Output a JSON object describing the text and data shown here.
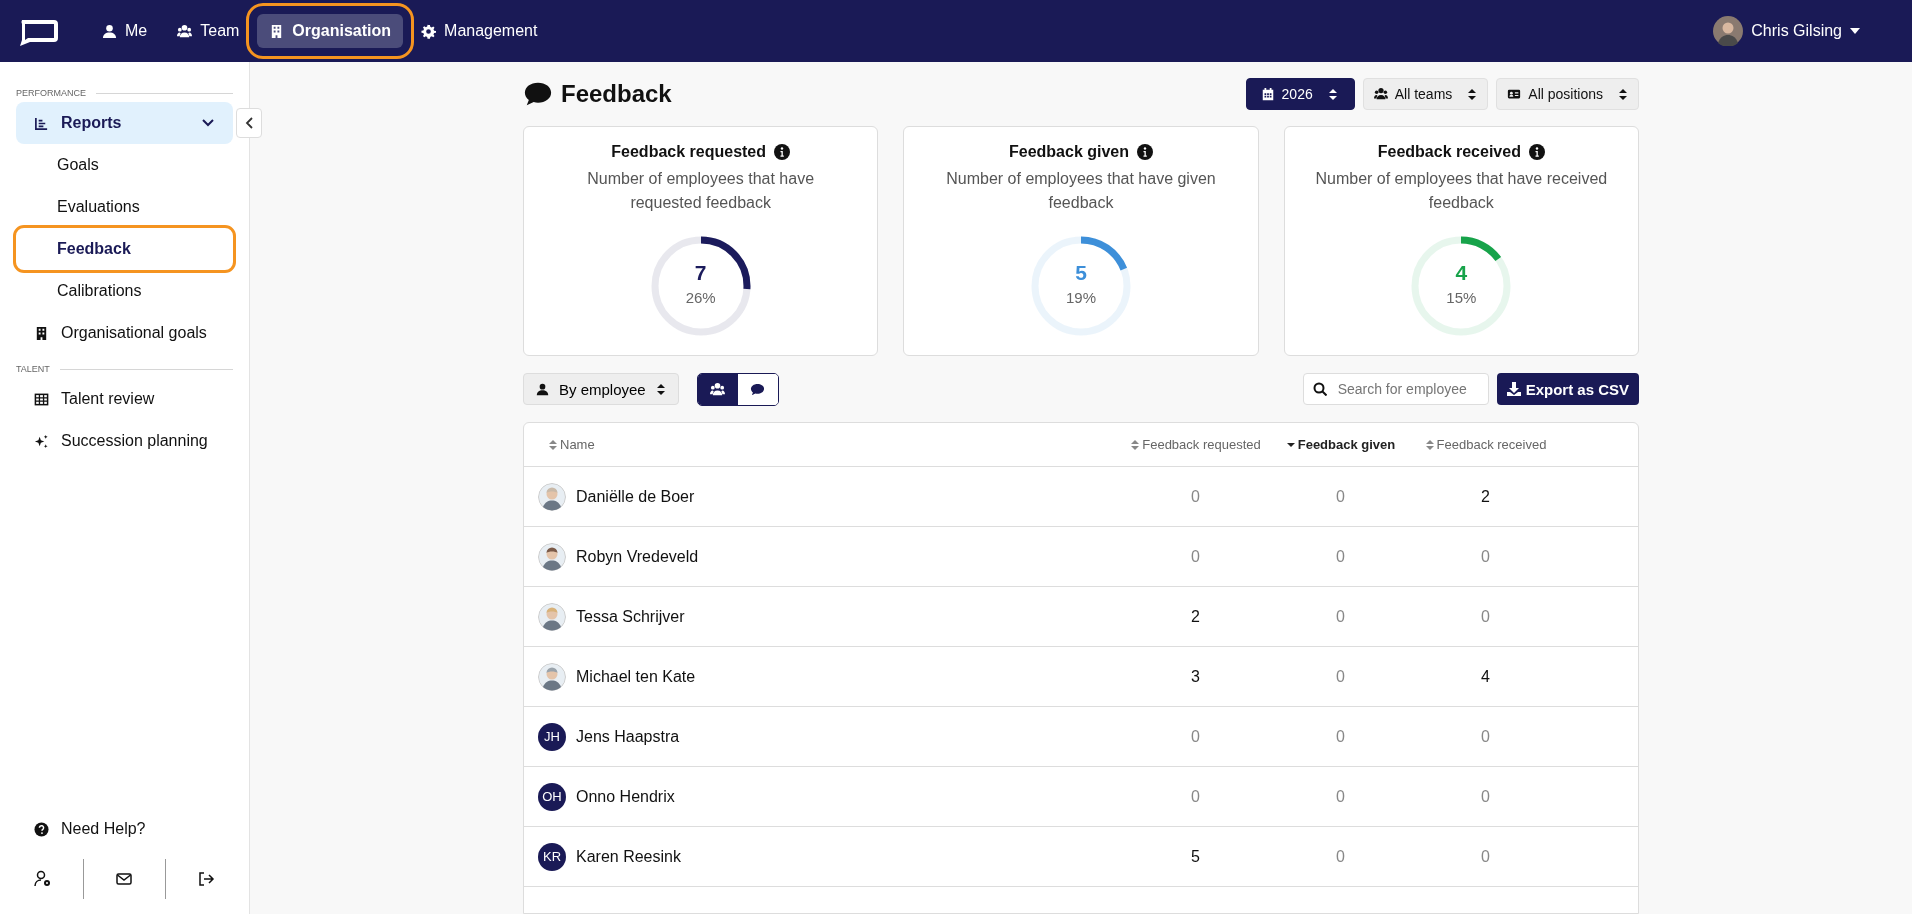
{
  "topbar": {
    "nav": [
      {
        "label": "Me",
        "selected": false,
        "highlighted": false
      },
      {
        "label": "Team",
        "selected": false,
        "highlighted": false
      },
      {
        "label": "Organisation",
        "selected": true,
        "highlighted": true
      },
      {
        "label": "Management",
        "selected": false,
        "highlighted": false
      }
    ],
    "user": {
      "name": "Chris Gilsing"
    }
  },
  "sidebar": {
    "sections": [
      {
        "label": "PERFORMANCE",
        "items": [
          {
            "label": "Reports",
            "expanded": true,
            "selected": true,
            "children": [
              {
                "label": "Goals",
                "selected": false,
                "highlighted": false
              },
              {
                "label": "Evaluations",
                "selected": false,
                "highlighted": false
              },
              {
                "label": "Feedback",
                "selected": true,
                "highlighted": true
              },
              {
                "label": "Calibrations",
                "selected": false,
                "highlighted": false
              }
            ]
          },
          {
            "label": "Organisational goals",
            "selected": false
          }
        ]
      },
      {
        "label": "TALENT",
        "items": [
          {
            "label": "Talent review",
            "selected": false
          },
          {
            "label": "Succession planning",
            "selected": false
          }
        ]
      }
    ],
    "help": "Need Help?"
  },
  "page": {
    "title": "Feedback",
    "filters": [
      {
        "label": "2026",
        "primary": true
      },
      {
        "label": "All teams",
        "primary": false
      },
      {
        "label": "All positions",
        "primary": false
      }
    ],
    "cards": [
      {
        "title": "Feedback requested",
        "description": "Number of employees that have requested feedback",
        "value": "7",
        "percent": "26%",
        "level": 0.26,
        "color": "#1b1b5c"
      },
      {
        "title": "Feedback given",
        "description": "Number of employees that have given feedback",
        "value": "5",
        "percent": "19%",
        "level": 0.19,
        "color": "#3d8fd9"
      },
      {
        "title": "Feedback received",
        "description": "Number of employees that have received feedback",
        "value": "4",
        "percent": "15%",
        "level": 0.15,
        "color": "#17a34a"
      }
    ],
    "group_by": "By employee",
    "view_toggle": [
      {
        "selected": true
      },
      {
        "selected": false
      }
    ],
    "search": {
      "placeholder": "Search for employee"
    },
    "export": "Export as CSV"
  },
  "table": {
    "columns": [
      {
        "label": "Name",
        "sorted": false
      },
      {
        "label": "Feedback requested",
        "sorted": false
      },
      {
        "label": "Feedback given",
        "sorted": true
      },
      {
        "label": "Feedback received",
        "sorted": false
      }
    ],
    "rows": [
      {
        "name": "Daniëlle de Boer",
        "avatar": {
          "kind": "photo"
        },
        "values": [
          {
            "text": "0",
            "muted": true
          },
          {
            "text": "0",
            "muted": true
          },
          {
            "text": "2",
            "muted": false
          }
        ]
      },
      {
        "name": "Robyn Vredeveld",
        "avatar": {
          "kind": "photo"
        },
        "values": [
          {
            "text": "0",
            "muted": true
          },
          {
            "text": "0",
            "muted": true
          },
          {
            "text": "0",
            "muted": true
          }
        ]
      },
      {
        "name": "Tessa Schrijver",
        "avatar": {
          "kind": "photo"
        },
        "values": [
          {
            "text": "2",
            "muted": false
          },
          {
            "text": "0",
            "muted": true
          },
          {
            "text": "0",
            "muted": true
          }
        ]
      },
      {
        "name": "Michael ten Kate",
        "avatar": {
          "kind": "photo"
        },
        "values": [
          {
            "text": "3",
            "muted": false
          },
          {
            "text": "0",
            "muted": true
          },
          {
            "text": "4",
            "muted": false
          }
        ]
      },
      {
        "name": "Jens Haapstra",
        "avatar": {
          "kind": "initials",
          "text": "JH"
        },
        "values": [
          {
            "text": "0",
            "muted": true
          },
          {
            "text": "0",
            "muted": true
          },
          {
            "text": "0",
            "muted": true
          }
        ]
      },
      {
        "name": "Onno Hendrix",
        "avatar": {
          "kind": "initials",
          "text": "OH"
        },
        "values": [
          {
            "text": "0",
            "muted": true
          },
          {
            "text": "0",
            "muted": true
          },
          {
            "text": "0",
            "muted": true
          }
        ]
      },
      {
        "name": "Karen Reesink",
        "avatar": {
          "kind": "initials",
          "text": "KR"
        },
        "values": [
          {
            "text": "5",
            "muted": false
          },
          {
            "text": "0",
            "muted": true
          },
          {
            "text": "0",
            "muted": true
          }
        ]
      }
    ]
  }
}
